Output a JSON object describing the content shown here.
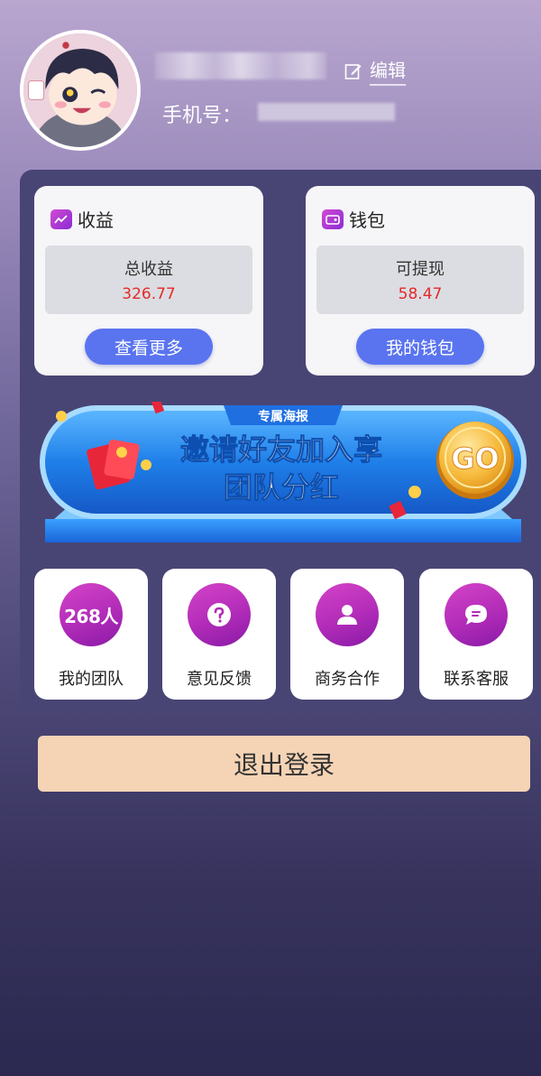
{
  "profile": {
    "edit_label": "编辑",
    "phone_label": "手机号："
  },
  "earnings_card": {
    "title": "收益",
    "stat_label": "总收益",
    "stat_value": "326.77",
    "button": "查看更多"
  },
  "wallet_card": {
    "title": "钱包",
    "stat_label": "可提现",
    "stat_value": "58.47",
    "button": "我的钱包"
  },
  "banner": {
    "tag": "专属海报",
    "line1": "邀请好友加入享",
    "line2": "团队分红",
    "go": "GO"
  },
  "tiles": [
    {
      "label": "我的团队",
      "badge": "268人",
      "icon": "team-count"
    },
    {
      "label": "意见反馈",
      "icon": "question-icon"
    },
    {
      "label": "商务合作",
      "icon": "person-icon"
    },
    {
      "label": "联系客服",
      "icon": "chat-icon"
    }
  ],
  "logout_label": "退出登录",
  "colors": {
    "accent_button": "#5a74f0",
    "value_red": "#e32a2a",
    "tile_circle": "#b12cb8",
    "logout_bg": "#f5d4b5",
    "panel_bg": "#484575"
  }
}
